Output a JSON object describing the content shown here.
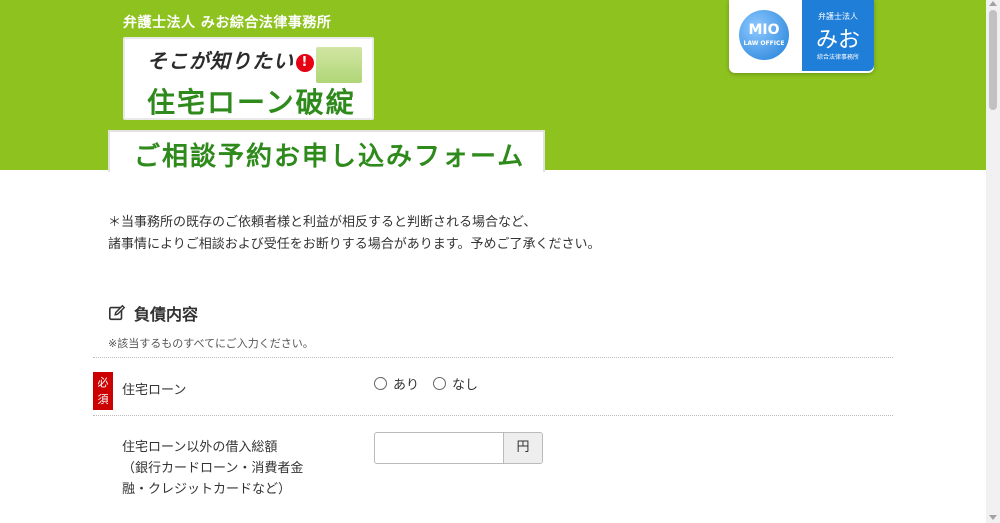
{
  "header": {
    "firm_name": "弁護士法人 みお綜合法律事務所",
    "logo_tagline": "そこが知りたい",
    "logo_title": "住宅ローン破綻",
    "form_title": "ご相談予約お申し込みフォーム",
    "brand_color": "#8dc21f",
    "badge": {
      "mio_text": "MIO",
      "mio_sub": "LAW OFFICE",
      "right_top": "弁護士法人",
      "right_main": "みお",
      "right_bottom": "綜合法律事務所"
    }
  },
  "notice": {
    "line1": "＊当事務所の既存のご依頼者様と利益が相反すると判断される場合など、",
    "line2": "諸事情によりご相談および受任をお断りする場合があります。予めご了承ください。"
  },
  "section": {
    "title": "負債内容",
    "note": "※該当するものすべてにご入力ください。",
    "icon": "pencil-square-icon"
  },
  "fields": {
    "housing_loan": {
      "required_label": "必須",
      "label": "住宅ローン",
      "options": [
        "あり",
        "なし"
      ]
    },
    "other_debt": {
      "label_line1": "住宅ローン以外の借入総額",
      "label_line2": "（銀行カードローン・消費者金",
      "label_line3": "融・クレジットカードなど）",
      "value": "",
      "unit": "円"
    }
  }
}
